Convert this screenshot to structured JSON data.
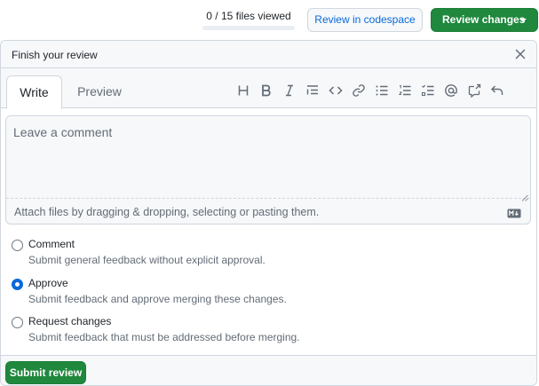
{
  "topbar": {
    "files_viewed": "0 / 15 files viewed",
    "files_viewed_progress": 0,
    "codespace_label": "Review in codespace",
    "review_changes_label": "Review changes"
  },
  "panel": {
    "title": "Finish your review",
    "tabs": [
      {
        "label": "Write",
        "active": true
      },
      {
        "label": "Preview",
        "active": false
      }
    ],
    "toolbar_icons": [
      "heading-icon",
      "bold-icon",
      "italic-icon",
      "quote-icon",
      "code-icon",
      "link-icon",
      "unordered-list-icon",
      "ordered-list-icon",
      "task-list-icon",
      "mention-icon",
      "cross-reference-icon",
      "undo-icon"
    ],
    "comment_placeholder": "Leave a comment",
    "comment_value": "",
    "attach_hint": "Attach files by dragging & dropping, selecting or pasting them.",
    "markdown_badge": "markdown-icon"
  },
  "options": [
    {
      "label": "Comment",
      "desc": "Submit general feedback without explicit approval.",
      "checked": false
    },
    {
      "label": "Approve",
      "desc": "Submit feedback and approve merging these changes.",
      "checked": true
    },
    {
      "label": "Request changes",
      "desc": "Submit feedback that must be addressed before merging.",
      "checked": false
    }
  ],
  "footer": {
    "submit_label": "Submit review"
  },
  "colors": {
    "primary_green": "#1f883d",
    "accent_blue": "#0969da",
    "border": "#d0d7de",
    "muted_text": "#636c76"
  }
}
